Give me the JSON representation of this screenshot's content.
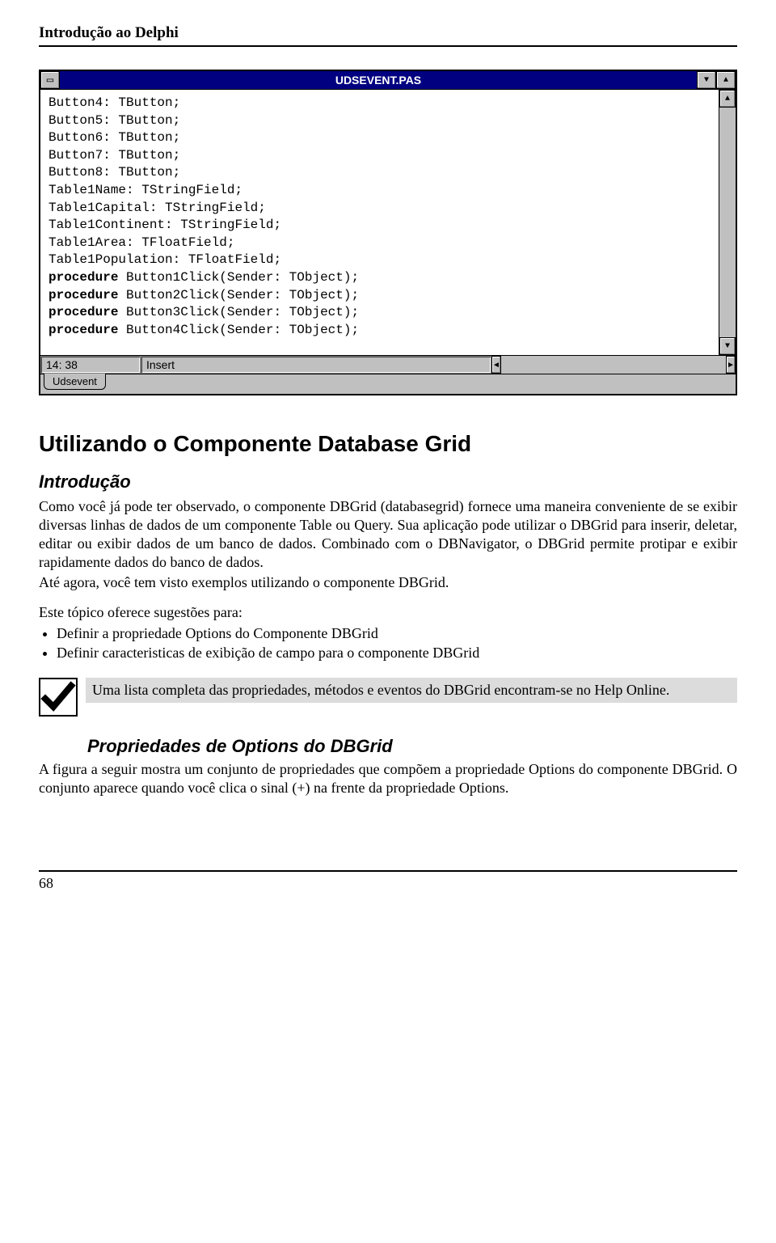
{
  "header": {
    "title": "Introdução ao Delphi"
  },
  "window": {
    "title": "UDSEVENT.PAS",
    "code_lines": [
      {
        "t": "Button4: TButton;"
      },
      {
        "t": "Button5: TButton;"
      },
      {
        "t": "Button6: TButton;"
      },
      {
        "t": "Button7: TButton;"
      },
      {
        "t": "Button8: TButton;"
      },
      {
        "t": "Table1Name: TStringField;"
      },
      {
        "t": "Table1Capital: TStringField;"
      },
      {
        "t": "Table1Continent: TStringField;"
      },
      {
        "t": "Table1Area: TFloatField;"
      },
      {
        "t": "Table1Population: TFloatField;"
      },
      {
        "kw": "procedure",
        "t": " Button1Click(Sender: TObject);"
      },
      {
        "kw": "procedure",
        "t": " Button2Click(Sender: TObject);"
      },
      {
        "kw": "procedure",
        "t": " Button3Click(Sender: TObject);"
      },
      {
        "kw": "procedure",
        "t": " Button4Click(Sender: TObject);"
      }
    ],
    "status": {
      "pos": "14: 38",
      "mode": "Insert"
    },
    "tab": "Udsevent"
  },
  "content": {
    "h1": "Utilizando o Componente Database Grid",
    "intro_h": "Introdução",
    "p1": "Como você já pode ter observado, o componente DBGrid (databasegrid) fornece uma maneira conveniente de se exibir diversas linhas de dados de um componente Table ou Query. Sua aplicação pode utilizar o DBGrid para inserir, deletar, editar ou exibir dados de um banco de dados. Combinado com o DBNavigator, o DBGrid permite protipar e exibir rapidamente dados do banco de dados.",
    "p2": "Até agora, você  tem visto exemplos utilizando o componente DBGrid.",
    "p3": "Este tópico oferece sugestões para:",
    "bullets": [
      "Definir a propriedade Options do Componente DBGrid",
      "Definir caracteristicas de exibição de campo para o componente DBGrid"
    ],
    "note": "Uma lista completa das propriedades, métodos e eventos do DBGrid encontram-se no Help Online.",
    "h2": "Propriedades de Options do DBGrid",
    "p4": "A figura a seguir mostra um conjunto de propriedades que compõem a propriedade Options do componente DBGrid. O conjunto aparece quando você clica o sinal (+) na frente da propriedade Options."
  },
  "footer": {
    "page": "68"
  }
}
